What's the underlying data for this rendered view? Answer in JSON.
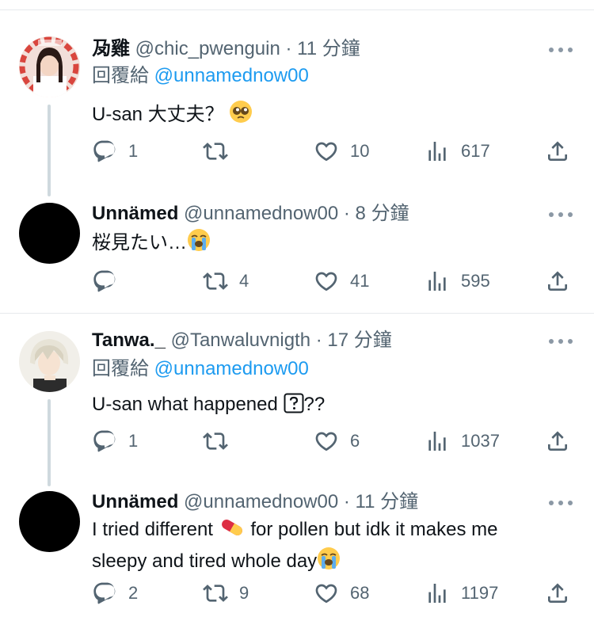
{
  "tweets": [
    {
      "name": "夃雞",
      "handle": "@chic_pwenguin",
      "sep": "·",
      "time": "11 分鐘",
      "reply_prefix": "回覆給",
      "reply_mention": "@unnamednow00",
      "text": "U-san 大丈夫？",
      "emoji": "pleading-face",
      "counts": {
        "reply": "1",
        "retweet": "",
        "like": "10",
        "views": "617"
      }
    },
    {
      "name": "Unnämed",
      "handle": "@unnamednow00",
      "sep": "·",
      "time": "8 分鐘",
      "text": "桜見たい…",
      "emoji": "loudly-crying-face",
      "counts": {
        "reply": "",
        "retweet": "4",
        "like": "41",
        "views": "595"
      }
    },
    {
      "name": "Tanwa._",
      "handle": "@Tanwaluvnigth",
      "sep": "·",
      "time": "17 分鐘",
      "reply_prefix": "回覆給",
      "reply_mention": "@unnamednow00",
      "text": "U-san what happened",
      "text_suffix": "??",
      "emoji": "question-box",
      "counts": {
        "reply": "1",
        "retweet": "",
        "like": "6",
        "views": "1037"
      }
    },
    {
      "name": "Unnämed",
      "handle": "@unnamednow00",
      "sep": "·",
      "time": "11 分鐘",
      "text_line1_a": "I tried different",
      "text_line1_b": "for pollen but idk it makes me",
      "text_line2": "sleepy and tired whole day",
      "emoji1": "pill",
      "emoji2": "loudly-crying-face",
      "counts": {
        "reply": "2",
        "retweet": "9",
        "like": "68",
        "views": "1197"
      }
    }
  ],
  "colors": {
    "text": "#0f1419",
    "muted": "#536471",
    "link": "#1d9bf0",
    "divider": "#e6e9ec",
    "connector": "#cfd9de"
  }
}
